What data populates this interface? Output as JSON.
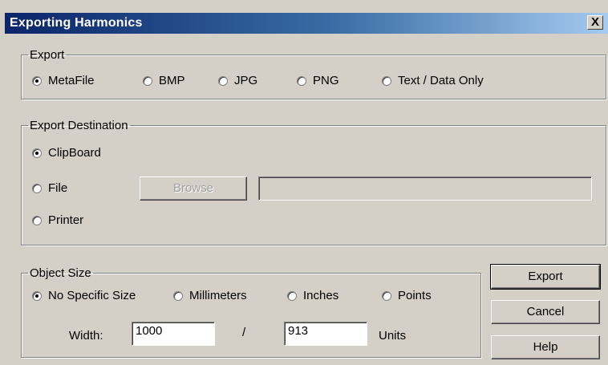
{
  "window": {
    "title": "Exporting Harmonics",
    "close_label": "X"
  },
  "export": {
    "legend": "Export",
    "options": [
      "MetaFile",
      "BMP",
      "JPG",
      "PNG",
      "Text / Data Only"
    ],
    "selected": "MetaFile"
  },
  "destination": {
    "legend": "Export Destination",
    "options": [
      "ClipBoard",
      "File",
      "Printer"
    ],
    "selected": "ClipBoard",
    "browse_label": "Browse",
    "path_value": ""
  },
  "object_size": {
    "legend": "Object Size",
    "options": [
      "No Specific Size",
      "Millimeters",
      "Inches",
      "Points"
    ],
    "selected": "No Specific Size",
    "width_label": "Width:",
    "width_value": "1000",
    "separator": "/",
    "height_value": "913",
    "units_label": "Units"
  },
  "buttons": {
    "export": "Export",
    "cancel": "Cancel",
    "help": "Help"
  }
}
